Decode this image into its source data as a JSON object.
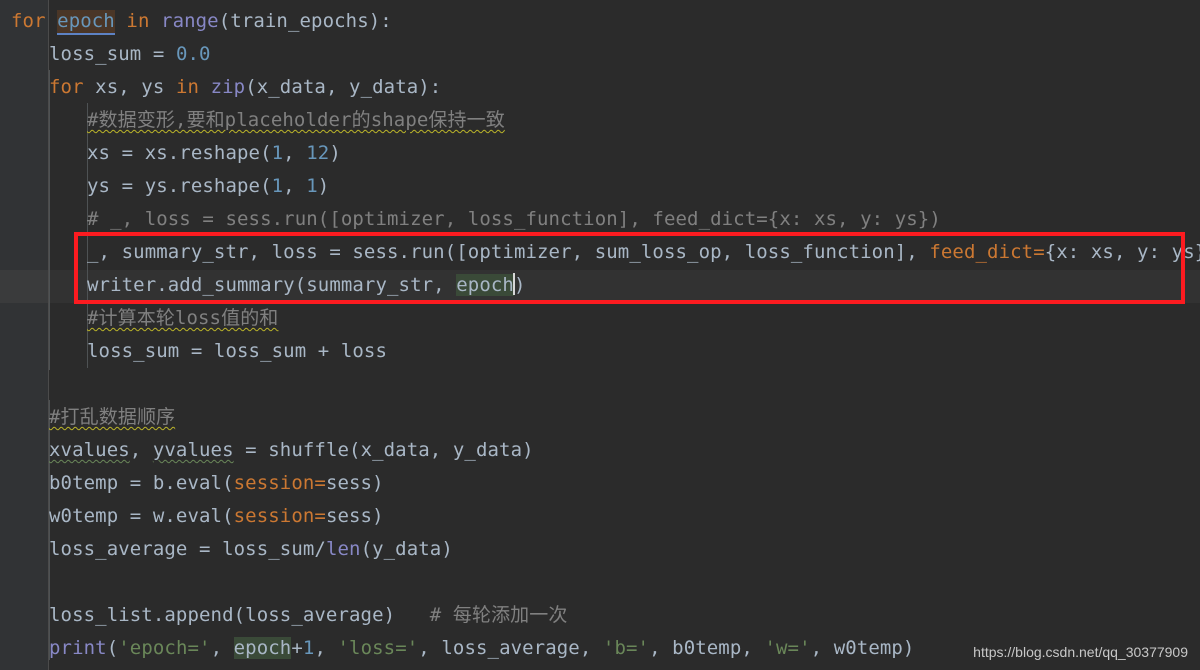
{
  "editor": {
    "theme": "darcula-dark",
    "background": "#2b2b2b",
    "gutter_background": "#313335",
    "current_line_background": "#323232",
    "default_text_color": "#a9b7c6",
    "keyword_color": "#cc7832",
    "number_color": "#6897bb",
    "string_color": "#6a8759",
    "comment_color": "#808080",
    "function_color": "#8888c6",
    "caret_identifier_write_background": "#4a3627",
    "caret_identifier_read_background": "#3a4a38",
    "annotation_box_color": "#fc1b20"
  },
  "lines": [
    {
      "n": 1,
      "indent": 0,
      "tokens": [
        {
          "t": "for ",
          "c": "kw"
        },
        {
          "t": "epoch",
          "c": "hl-write"
        },
        {
          "t": " ",
          "c": "punct"
        },
        {
          "t": "in ",
          "c": "kw"
        },
        {
          "t": "range",
          "c": "fn"
        },
        {
          "t": "(train_epochs):",
          "c": "ident"
        }
      ]
    },
    {
      "n": 2,
      "indent": 1,
      "tokens": [
        {
          "t": "loss_sum = ",
          "c": "ident"
        },
        {
          "t": "0.0",
          "c": "num"
        }
      ]
    },
    {
      "n": 3,
      "indent": 1,
      "tokens": [
        {
          "t": "for ",
          "c": "kw"
        },
        {
          "t": "xs, ys ",
          "c": "ident"
        },
        {
          "t": "in ",
          "c": "kw"
        },
        {
          "t": "zip",
          "c": "fn"
        },
        {
          "t": "(x_data, y_data):",
          "c": "ident"
        }
      ]
    },
    {
      "n": 4,
      "indent": 2,
      "tokens": [
        {
          "t": "#数据变形,要和placeholder的shape保持一致",
          "c": "comment wavy"
        }
      ]
    },
    {
      "n": 5,
      "indent": 2,
      "tokens": [
        {
          "t": "xs = xs.reshape(",
          "c": "ident"
        },
        {
          "t": "1",
          "c": "num"
        },
        {
          "t": ", ",
          "c": "ident"
        },
        {
          "t": "12",
          "c": "num"
        },
        {
          "t": ")",
          "c": "ident"
        }
      ]
    },
    {
      "n": 6,
      "indent": 2,
      "tokens": [
        {
          "t": "ys = ys.reshape(",
          "c": "ident"
        },
        {
          "t": "1",
          "c": "num"
        },
        {
          "t": ", ",
          "c": "ident"
        },
        {
          "t": "1",
          "c": "num"
        },
        {
          "t": ")",
          "c": "ident"
        }
      ]
    },
    {
      "n": 7,
      "indent": 2,
      "tokens": [
        {
          "t": "# _, loss = sess.run([optimizer, loss_function], feed_dict={x: xs, y: ys})",
          "c": "comment"
        }
      ]
    },
    {
      "n": 8,
      "indent": 2,
      "tokens": [
        {
          "t": "_, summary_str, loss = sess.run([optimizer, sum_loss_op, loss_function], ",
          "c": "ident"
        },
        {
          "t": "feed_dict=",
          "c": "kwarg"
        },
        {
          "t": "{x: xs, y: ys})",
          "c": "ident"
        }
      ]
    },
    {
      "n": 9,
      "indent": 2,
      "current": true,
      "tokens": [
        {
          "t": "writer.add_summary(summary_str, ",
          "c": "ident"
        },
        {
          "t": "epoch",
          "c": "hl-read"
        },
        {
          "t": "|CARET|",
          "c": "caret"
        },
        {
          "t": ")",
          "c": "ident"
        }
      ]
    },
    {
      "n": 10,
      "indent": 2,
      "tokens": [
        {
          "t": "#计算本轮loss值的和",
          "c": "comment wavy"
        }
      ]
    },
    {
      "n": 11,
      "indent": 2,
      "tokens": [
        {
          "t": "loss_sum = loss_sum + loss",
          "c": "ident"
        }
      ]
    },
    {
      "n": 12,
      "indent": 0,
      "tokens": []
    },
    {
      "n": 13,
      "indent": 1,
      "tokens": [
        {
          "t": "#打乱数据顺序",
          "c": "comment wavy"
        }
      ]
    },
    {
      "n": 14,
      "indent": 1,
      "tokens": [
        {
          "t": "xvalues",
          "c": "ident wavy-green"
        },
        {
          "t": ", ",
          "c": "ident"
        },
        {
          "t": "yvalues",
          "c": "ident wavy-green"
        },
        {
          "t": " = shuffle(x_data, y_data)",
          "c": "ident"
        }
      ]
    },
    {
      "n": 15,
      "indent": 1,
      "tokens": [
        {
          "t": "b0temp = b.eval(",
          "c": "ident"
        },
        {
          "t": "session=",
          "c": "kwarg"
        },
        {
          "t": "sess)",
          "c": "ident"
        }
      ]
    },
    {
      "n": 16,
      "indent": 1,
      "tokens": [
        {
          "t": "w0temp = w.eval(",
          "c": "ident"
        },
        {
          "t": "session=",
          "c": "kwarg"
        },
        {
          "t": "sess)",
          "c": "ident"
        }
      ]
    },
    {
      "n": 17,
      "indent": 1,
      "tokens": [
        {
          "t": "loss_average = loss_sum/",
          "c": "ident"
        },
        {
          "t": "len",
          "c": "fn"
        },
        {
          "t": "(y_data)",
          "c": "ident"
        }
      ]
    },
    {
      "n": 18,
      "indent": 0,
      "tokens": []
    },
    {
      "n": 19,
      "indent": 1,
      "tokens": [
        {
          "t": "loss_list.append(loss_average)   ",
          "c": "ident"
        },
        {
          "t": "# 每轮添加一次",
          "c": "comment"
        }
      ]
    },
    {
      "n": 20,
      "indent": 1,
      "tokens": [
        {
          "t": "print",
          "c": "fn"
        },
        {
          "t": "(",
          "c": "ident"
        },
        {
          "t": "'epoch='",
          "c": "str"
        },
        {
          "t": ", ",
          "c": "ident"
        },
        {
          "t": "epoch",
          "c": "hl-read"
        },
        {
          "t": "+",
          "c": "ident"
        },
        {
          "t": "1",
          "c": "num"
        },
        {
          "t": ", ",
          "c": "ident"
        },
        {
          "t": "'loss='",
          "c": "str"
        },
        {
          "t": ", loss_average, ",
          "c": "ident"
        },
        {
          "t": "'b='",
          "c": "str"
        },
        {
          "t": ", b0temp, ",
          "c": "ident"
        },
        {
          "t": "'w='",
          "c": "str"
        },
        {
          "t": ", w0temp)",
          "c": "ident"
        }
      ]
    }
  ],
  "annotation": {
    "type": "red-rectangle",
    "covers_lines": [
      8,
      9
    ],
    "color": "#fc1b20"
  },
  "watermark": {
    "text": "https://blog.csdn.net/qq_30377909"
  }
}
